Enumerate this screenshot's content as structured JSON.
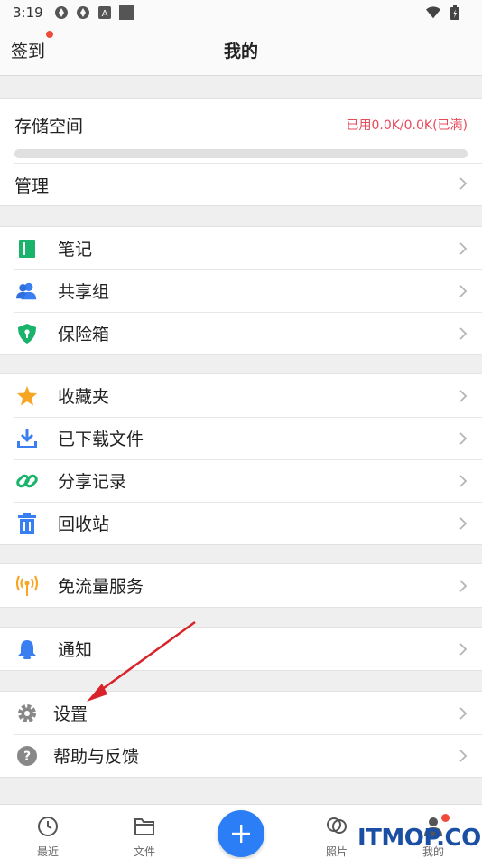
{
  "status_bar": {
    "time": "3:19"
  },
  "header": {
    "signin_label": "签到",
    "title": "我的"
  },
  "storage": {
    "label": "存储空间",
    "used_text": "已用0.0K/0.0K(已满)",
    "used_fraction": 1.0,
    "manage_label": "管理"
  },
  "group1": [
    {
      "label": "笔记",
      "icon": "notebook-icon",
      "color": "#19b36b"
    },
    {
      "label": "共享组",
      "icon": "users-icon",
      "color": "#3a7ff2"
    },
    {
      "label": "保险箱",
      "icon": "shield-icon",
      "color": "#19b36b"
    }
  ],
  "group2": [
    {
      "label": "收藏夹",
      "icon": "star-icon",
      "color": "#f6a623"
    },
    {
      "label": "已下载文件",
      "icon": "download-icon",
      "color": "#3a7ff2"
    },
    {
      "label": "分享记录",
      "icon": "link-icon",
      "color": "#19b36b"
    },
    {
      "label": "回收站",
      "icon": "trash-icon",
      "color": "#3a7ff2"
    }
  ],
  "group3": [
    {
      "label": "免流量服务",
      "icon": "signal-icon",
      "color": "#f6a623"
    }
  ],
  "group4": [
    {
      "label": "通知",
      "icon": "bell-icon",
      "color": "#3a7ff2"
    }
  ],
  "group5": [
    {
      "label": "设置",
      "icon": "gear-icon",
      "color": "#888888"
    },
    {
      "label": "帮助与反馈",
      "icon": "help-icon",
      "color": "#888888"
    }
  ],
  "tabbar": {
    "recent": "最近",
    "files": "文件",
    "photos": "照片",
    "mine": "我的"
  },
  "watermark": "ITMOP.COM",
  "colors": {
    "accent": "#2b7ef6",
    "alert": "#e84a5a"
  }
}
